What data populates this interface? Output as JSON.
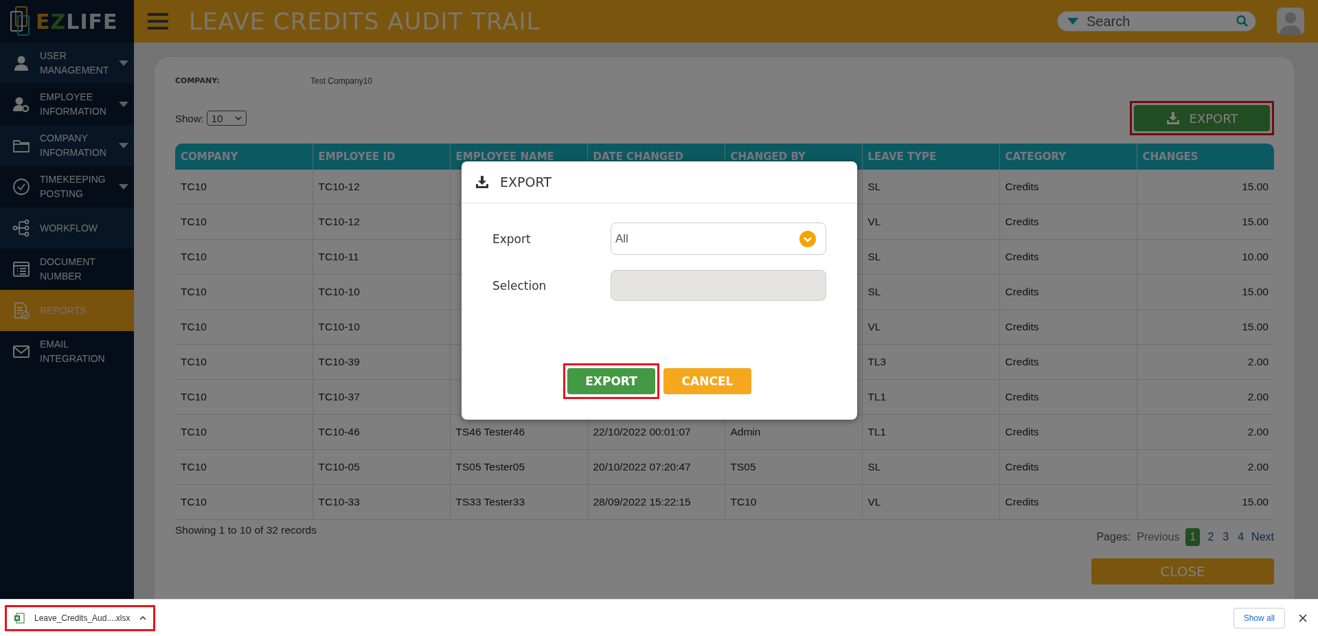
{
  "logo": [
    "E",
    "Z",
    "LIFE"
  ],
  "sidebar": {
    "items": [
      {
        "label": "USER MANAGEMENT",
        "has_submenu": true,
        "selected": false
      },
      {
        "label": "EMPLOYEE INFORMATION",
        "has_submenu": true,
        "selected": false
      },
      {
        "label": "COMPANY INFORMATION",
        "has_submenu": true,
        "selected": false
      },
      {
        "label": "TIMEKEEPING POSTING",
        "has_submenu": true,
        "selected": false
      },
      {
        "label": "WORKFLOW",
        "has_submenu": false,
        "selected": false
      },
      {
        "label": "DOCUMENT NUMBER",
        "has_submenu": false,
        "selected": false
      },
      {
        "label": "REPORTS",
        "has_submenu": false,
        "selected": true
      },
      {
        "label": "EMAIL INTEGRATION",
        "has_submenu": false,
        "selected": false
      }
    ]
  },
  "header": {
    "title": "LEAVE CREDITS AUDIT TRAIL",
    "search": {
      "placeholder": "Search"
    }
  },
  "card": {
    "company_label": "COMPANY:",
    "company_value": "Test Company10",
    "show_label": "Show:",
    "show_value": "10",
    "export_button": {
      "label": "EXPORT",
      "highlighted": true
    },
    "table": {
      "columns": [
        "COMPANY",
        "EMPLOYEE ID",
        "EMPLOYEE NAME",
        "DATE CHANGED",
        "CHANGED BY",
        "LEAVE TYPE",
        "CATEGORY",
        "CHANGES"
      ],
      "rows": [
        [
          "TC10",
          "TC10-12",
          null,
          null,
          null,
          "SL",
          "Credits",
          "15.00"
        ],
        [
          "TC10",
          "TC10-12",
          null,
          null,
          null,
          "VL",
          "Credits",
          "15.00"
        ],
        [
          "TC10",
          "TC10-11",
          null,
          null,
          null,
          "SL",
          "Credits",
          "10.00"
        ],
        [
          "TC10",
          "TC10-10",
          null,
          null,
          null,
          "SL",
          "Credits",
          "15.00"
        ],
        [
          "TC10",
          "TC10-10",
          null,
          null,
          null,
          "VL",
          "Credits",
          "15.00"
        ],
        [
          "TC10",
          "TC10-39",
          null,
          null,
          null,
          "TL3",
          "Credits",
          "2.00"
        ],
        [
          "TC10",
          "TC10-37",
          null,
          null,
          null,
          "TL1",
          "Credits",
          "2.00"
        ],
        [
          "TC10",
          "TC10-46",
          "TS46 Tester46",
          "22/10/2022 00:01:07",
          "Admin",
          "TL1",
          "Credits",
          "2.00"
        ],
        [
          "TC10",
          "TC10-05",
          "TS05 Tester05",
          "20/10/2022 07:20:47",
          "TS05",
          "SL",
          "Credits",
          "2.00"
        ],
        [
          "TC10",
          "TC10-33",
          "TS33 Tester33",
          "28/09/2022 15:22:15",
          "TC10",
          "VL",
          "Credits",
          "15.00"
        ]
      ]
    },
    "summary": "Showing 1 to 10 of 32 records",
    "pagination": {
      "label": "Pages:",
      "items": [
        {
          "label": "Previous",
          "kind": "nav",
          "disabled": true,
          "selected": false
        },
        {
          "label": "1",
          "kind": "page",
          "disabled": false,
          "selected": true
        },
        {
          "label": "2",
          "kind": "page",
          "disabled": false,
          "selected": false
        },
        {
          "label": "3",
          "kind": "page",
          "disabled": false,
          "selected": false
        },
        {
          "label": "4",
          "kind": "page",
          "disabled": false,
          "selected": false
        },
        {
          "label": "Next",
          "kind": "nav",
          "disabled": false,
          "selected": false
        }
      ]
    },
    "close_button": "CLOSE"
  },
  "modal": {
    "title": "EXPORT",
    "fields": [
      {
        "label": "Export",
        "kind": "select",
        "value": "All"
      },
      {
        "label": "Selection",
        "kind": "input",
        "disabled": true
      }
    ],
    "buttons": [
      {
        "label": "EXPORT",
        "kind": "primary",
        "highlighted": true
      },
      {
        "label": "CANCEL",
        "kind": "secondary",
        "highlighted": false
      }
    ]
  },
  "download_bar": {
    "file": {
      "name": "Leave_Credits_Aud....xlsx",
      "highlighted": true
    },
    "show_all": "Show all"
  }
}
